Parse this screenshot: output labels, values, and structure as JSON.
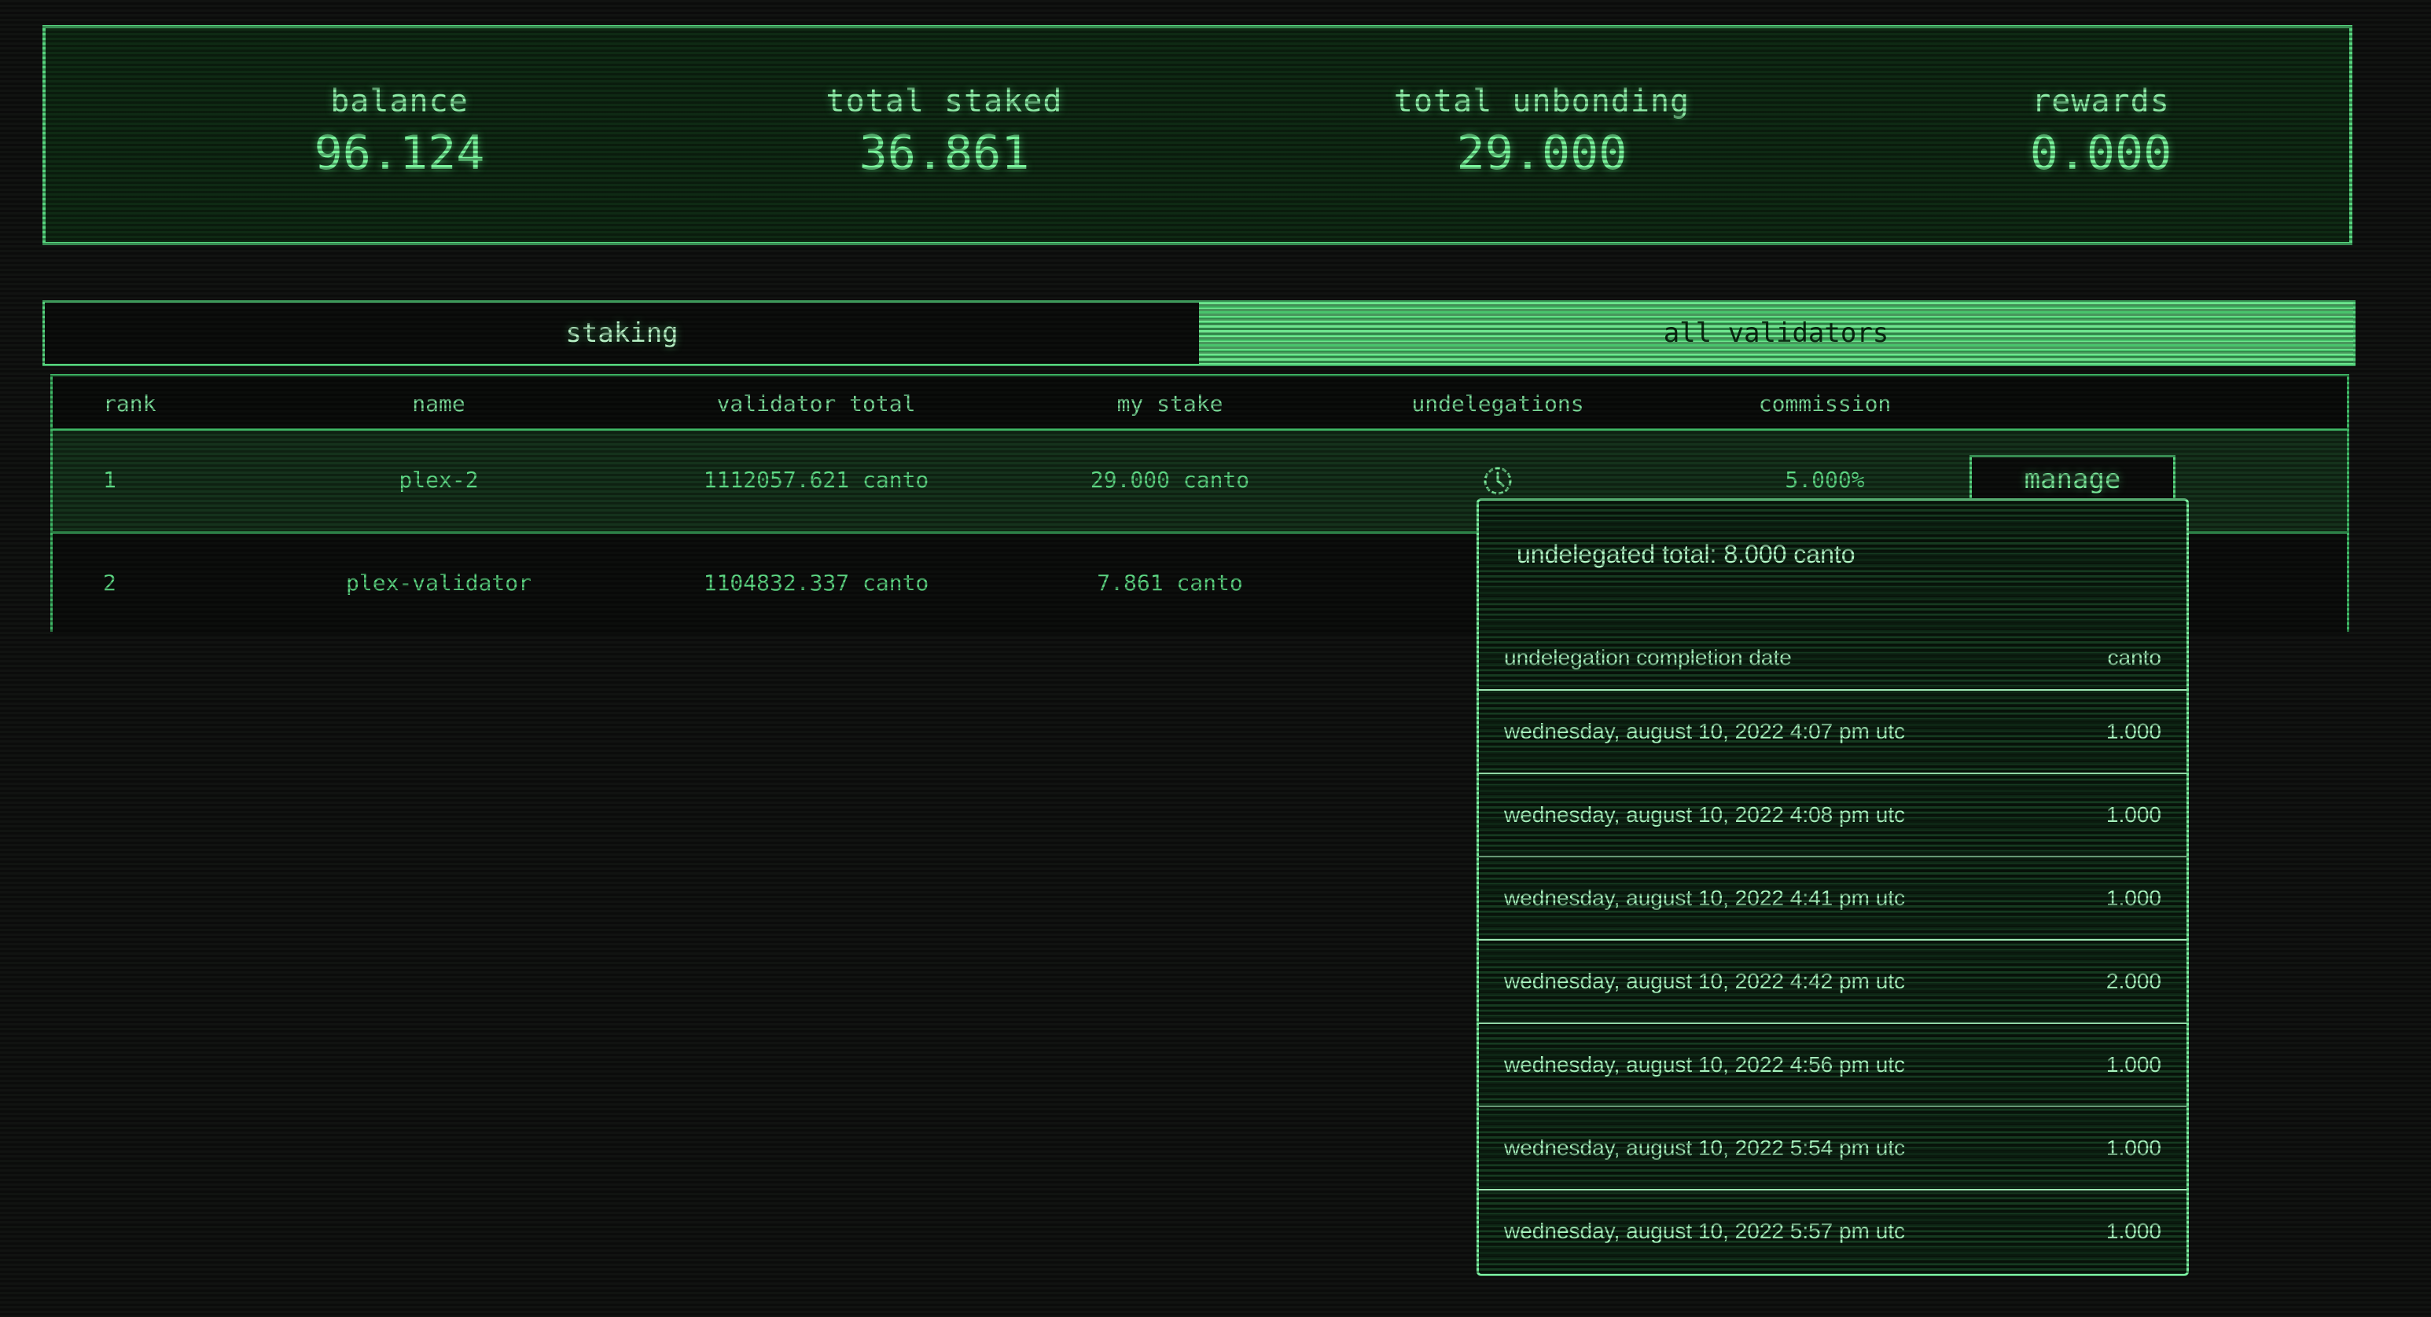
{
  "stats": [
    {
      "label": "balance",
      "value": "96.124"
    },
    {
      "label": "total staked",
      "value": "36.861"
    },
    {
      "label": "total unbonding",
      "value": "29.000"
    },
    {
      "label": "rewards",
      "value": "0.000"
    }
  ],
  "tabs": [
    {
      "label": "staking",
      "active": false
    },
    {
      "label": "all validators",
      "active": true
    }
  ],
  "table": {
    "headers": [
      "rank",
      "name",
      "validator total",
      "my stake",
      "undelegations",
      "commission"
    ],
    "rows": [
      {
        "rank": "1",
        "name": "plex-2",
        "validator_total": "1112057.621 canto",
        "my_stake": "29.000 canto",
        "undelegations_icon": "clock-icon",
        "commission": "5.000%",
        "action": "manage"
      },
      {
        "rank": "2",
        "name": "plex-validator",
        "validator_total": "1104832.337 canto",
        "my_stake": "7.861 canto"
      }
    ]
  },
  "popup": {
    "title": "undelegated total: 8.000 canto",
    "col_date": "undelegation completion date",
    "col_amount": "canto",
    "entries": [
      {
        "date": "wednesday, august 10, 2022 4:07 pm utc",
        "amount": "1.000"
      },
      {
        "date": "wednesday, august 10, 2022 4:08 pm utc",
        "amount": "1.000"
      },
      {
        "date": "wednesday, august 10, 2022 4:41 pm utc",
        "amount": "1.000"
      },
      {
        "date": "wednesday, august 10, 2022 4:42 pm utc",
        "amount": "2.000"
      },
      {
        "date": "wednesday, august 10, 2022 4:56 pm utc",
        "amount": "1.000"
      },
      {
        "date": "wednesday, august 10, 2022 5:54 pm utc",
        "amount": "1.000"
      },
      {
        "date": "wednesday, august 10, 2022 5:57 pm utc",
        "amount": "1.000"
      }
    ]
  },
  "colors": {
    "accent": "#56d67e",
    "text": "#5ef08a",
    "background": "#111311"
  }
}
